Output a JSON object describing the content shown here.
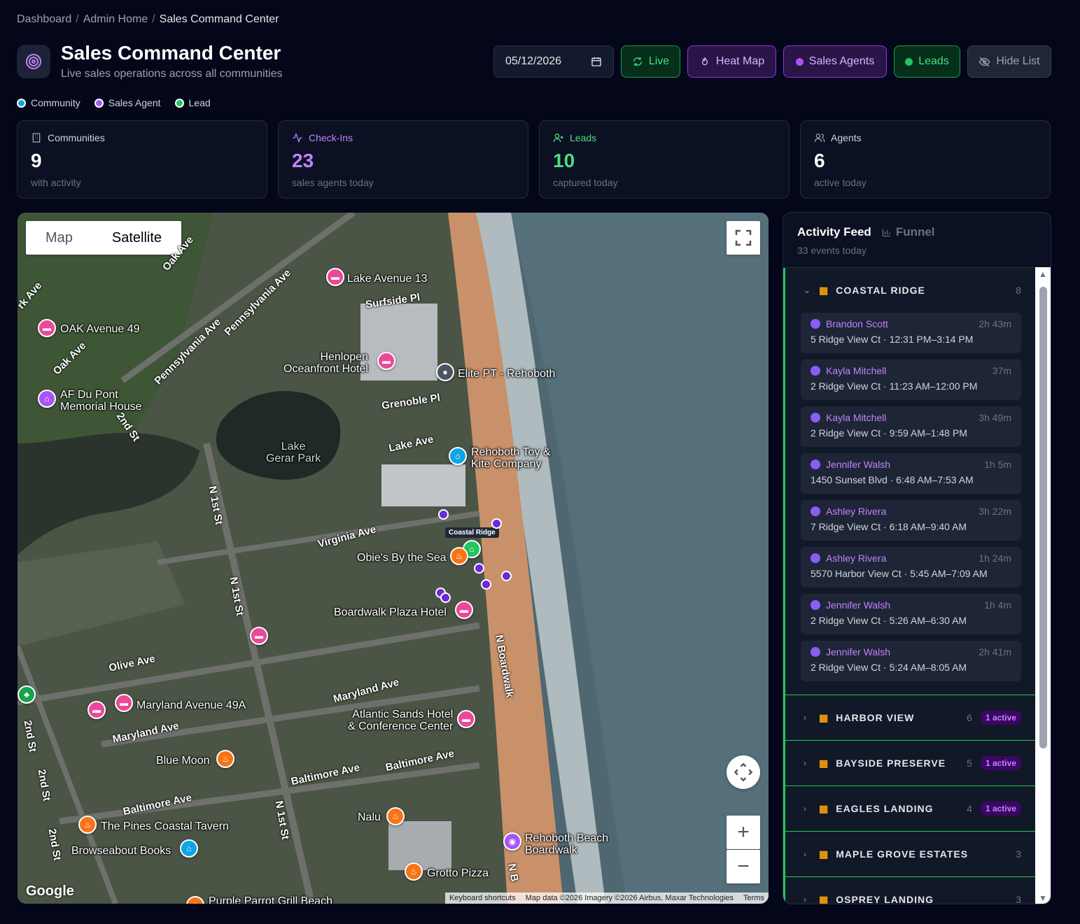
{
  "breadcrumb": {
    "items": [
      "Dashboard",
      "Admin Home"
    ],
    "current": "Sales Command Center",
    "separator": "/"
  },
  "header": {
    "title": "Sales Command Center",
    "subtitle": "Live sales operations across all communities"
  },
  "toolbar": {
    "date_value": "05/12/2026",
    "live_label": "Live",
    "heat_map_label": "Heat Map",
    "sales_agents_label": "Sales Agents",
    "leads_label": "Leads",
    "hide_list_label": "Hide List"
  },
  "legend": [
    {
      "label": "Community",
      "color": "#0ea5e9"
    },
    {
      "label": "Sales Agent",
      "color": "#a855f7"
    },
    {
      "label": "Lead",
      "color": "#22c55e"
    }
  ],
  "stats": {
    "communities": {
      "label": "Communities",
      "value": "9",
      "sub": "with activity",
      "color": "#ffffff"
    },
    "checkins": {
      "label": "Check-Ins",
      "value": "23",
      "sub": "sales agents today",
      "color": "#c084fc"
    },
    "leads": {
      "label": "Leads",
      "value": "10",
      "sub": "captured today",
      "color": "#4ade80"
    },
    "agents": {
      "label": "Agents",
      "value": "6",
      "sub": "active today",
      "color": "#ffffff"
    }
  },
  "map": {
    "type_map": "Map",
    "type_satellite": "Satellite",
    "logo": "Google",
    "keyboard_shortcuts": "Keyboard shortcuts",
    "map_data": "Map data ©2026 Imagery ©2026 Airbus, Maxar Technologies",
    "terms": "Terms",
    "zoom_in": "+",
    "zoom_out": "−",
    "community_tooltip": "Coastal Ridge",
    "places": {
      "lake_avenue_13": "Lake Avenue 13",
      "oak_avenue_49": "OAK Avenue 49",
      "henlopen": "Henlopen\nOceanfront Hotel",
      "elite_pt": "Elite PT - Rehoboth",
      "af_du_pont": "AF Du Pont\nMemorial House",
      "lake_gerar": "Lake\nGerar Park",
      "rehoboth_toy": "Rehoboth Toy &\nKite Company",
      "obies": "Obie's By the Sea",
      "boardwalk_plaza": "Boardwalk Plaza Hotel",
      "maryland_49a": "Maryland Avenue 49A",
      "atlantic_sands": "Atlantic Sands Hotel\n& Conference Center",
      "blue_moon": "Blue Moon",
      "nalu": "Nalu",
      "pines": "The Pines Coastal Tavern",
      "browseabout": "Browseabout Books",
      "rehoboth_beach_boardwalk": "Rehoboth Beach\nBoardwalk",
      "grotto": "Grotto Pizza",
      "purple_parrot": "Purple Parrot Grill Beach"
    },
    "streets": {
      "surfside": "Surfside Pl",
      "pennsylvania_1": "Pennsylvania Ave",
      "pennsylvania_2": "Pennsylvania Ave",
      "oak_1": "Oak Ave",
      "oak_2": "Oak Ave",
      "park": "rk Ave",
      "grenoble": "Grenoble Pl",
      "lake_ave": "Lake Ave",
      "second_st_1": "2nd St",
      "n_first_1": "N 1st St",
      "n_first_2": "N 1st St",
      "n_first_3": "N 1st St",
      "virginia": "Virginia Ave",
      "olive": "Olive Ave",
      "maryland_1": "Maryland Ave",
      "maryland_2": "Maryland Ave",
      "baltimore_1": "Baltimore Ave",
      "baltimore_2": "Baltimore Ave",
      "baltimore_3": "Baltimore Ave",
      "n_boardwalk_1": "N Boardwalk",
      "n_boardwalk_2": "N B",
      "second_st_2": "2nd St",
      "second_st_3": "2nd St",
      "second_st_4": "2nd St"
    }
  },
  "panel": {
    "tab_activity": "Activity Feed",
    "tab_funnel": "Funnel",
    "subtitle": "33 events today",
    "groups": [
      {
        "name": "COASTAL RIDGE",
        "count": "8",
        "entries": [
          {
            "agent": "Brandon Scott",
            "duration": "2h 43m",
            "detail": "5 Ridge View Ct · 12:31 PM–3:14 PM"
          },
          {
            "agent": "Kayla Mitchell",
            "duration": "37m",
            "detail": "2 Ridge View Ct · 11:23 AM–12:00 PM"
          },
          {
            "agent": "Kayla Mitchell",
            "duration": "3h 49m",
            "detail": "2 Ridge View Ct · 9:59 AM–1:48 PM"
          },
          {
            "agent": "Jennifer Walsh",
            "duration": "1h 5m",
            "detail": "1450 Sunset Blvd · 6:48 AM–7:53 AM"
          },
          {
            "agent": "Ashley Rivera",
            "duration": "3h 22m",
            "detail": "7 Ridge View Ct · 6:18 AM–9:40 AM"
          },
          {
            "agent": "Ashley Rivera",
            "duration": "1h 24m",
            "detail": "5570 Harbor View Ct · 5:45 AM–7:09 AM"
          },
          {
            "agent": "Jennifer Walsh",
            "duration": "1h 4m",
            "detail": "2 Ridge View Ct · 5:26 AM–6:30 AM"
          },
          {
            "agent": "Jennifer Walsh",
            "duration": "2h 41m",
            "detail": "2 Ridge View Ct · 5:24 AM–8:05 AM"
          }
        ]
      },
      {
        "name": "HARBOR VIEW",
        "count": "6",
        "badge": "1 active"
      },
      {
        "name": "BAYSIDE PRESERVE",
        "count": "5",
        "badge": "1 active"
      },
      {
        "name": "EAGLES LANDING",
        "count": "4",
        "badge": "1 active"
      },
      {
        "name": "MAPLE GROVE ESTATES",
        "count": "3"
      },
      {
        "name": "OSPREY LANDING",
        "count": "3"
      }
    ]
  }
}
